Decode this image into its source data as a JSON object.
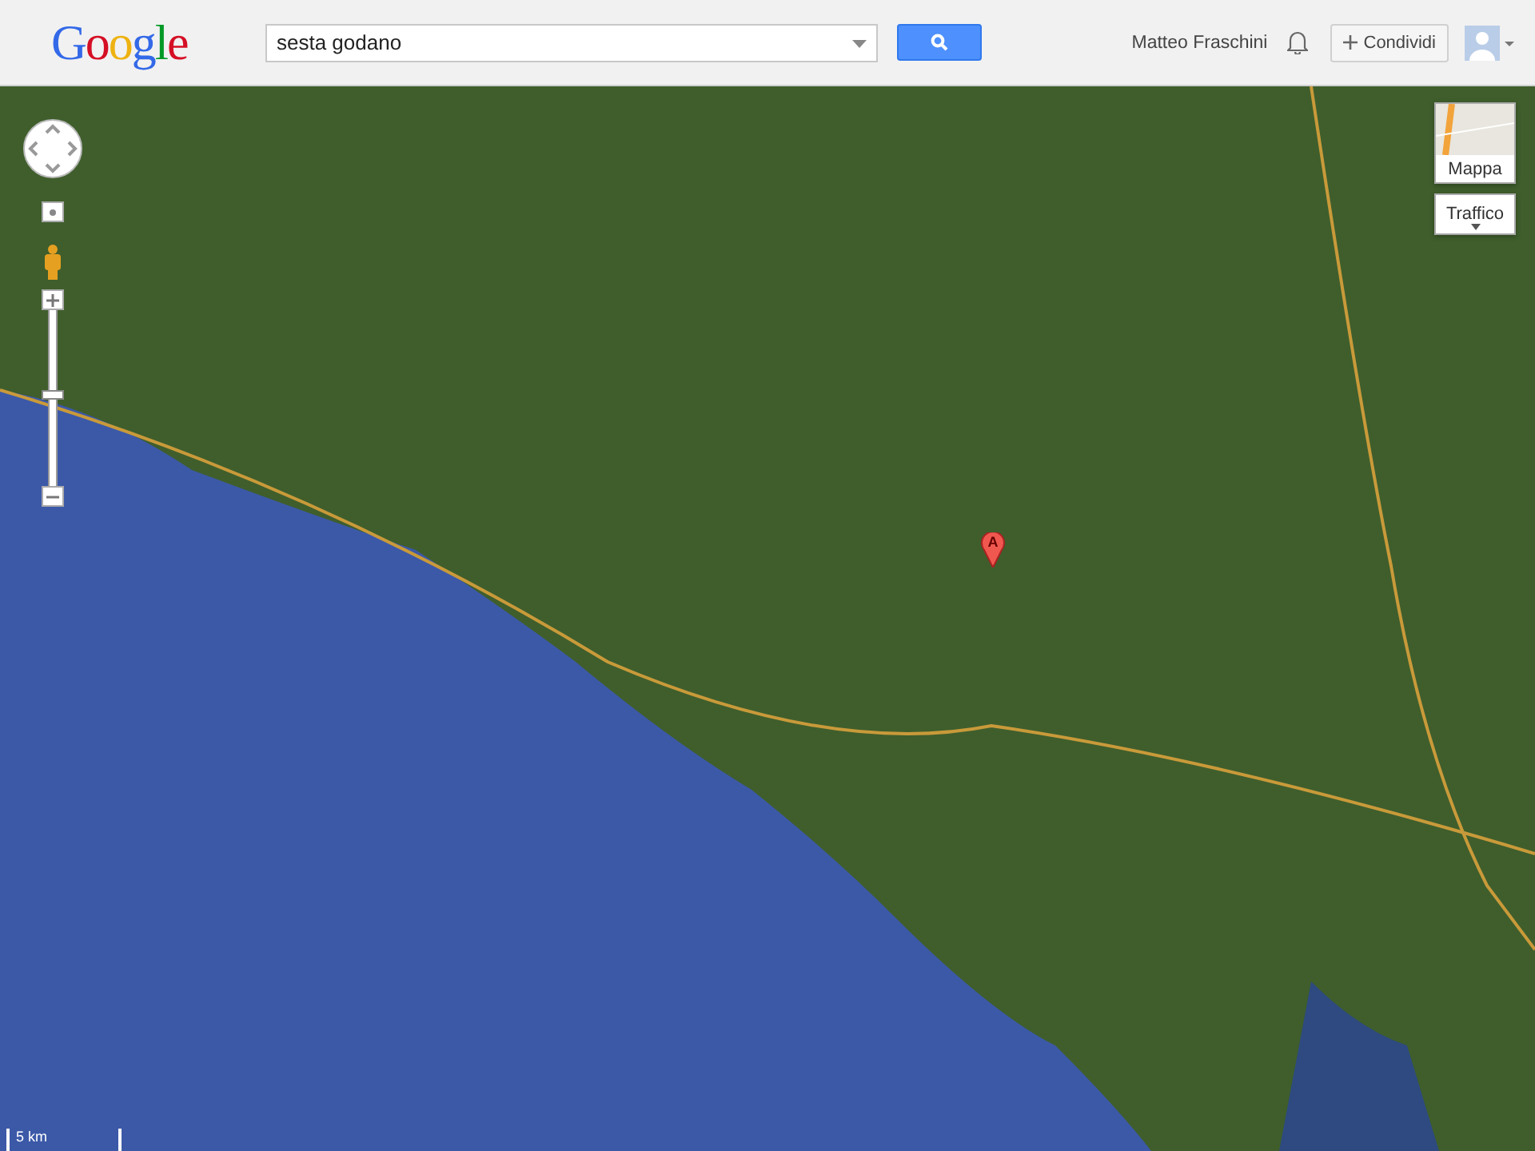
{
  "header": {
    "logo": "Google",
    "search": {
      "value": "sesta godano"
    },
    "user_name": "Matteo Fraschini",
    "share_button": "Condividi"
  },
  "map": {
    "marker": {
      "label": "A"
    },
    "zoom": {
      "level": 0.52
    },
    "layer_buttons": [
      {
        "label": "Mappa",
        "kind": "thumbnail"
      },
      {
        "label": "Traffico",
        "kind": "dropdown"
      }
    ],
    "scale": {
      "label": "5 km"
    }
  }
}
